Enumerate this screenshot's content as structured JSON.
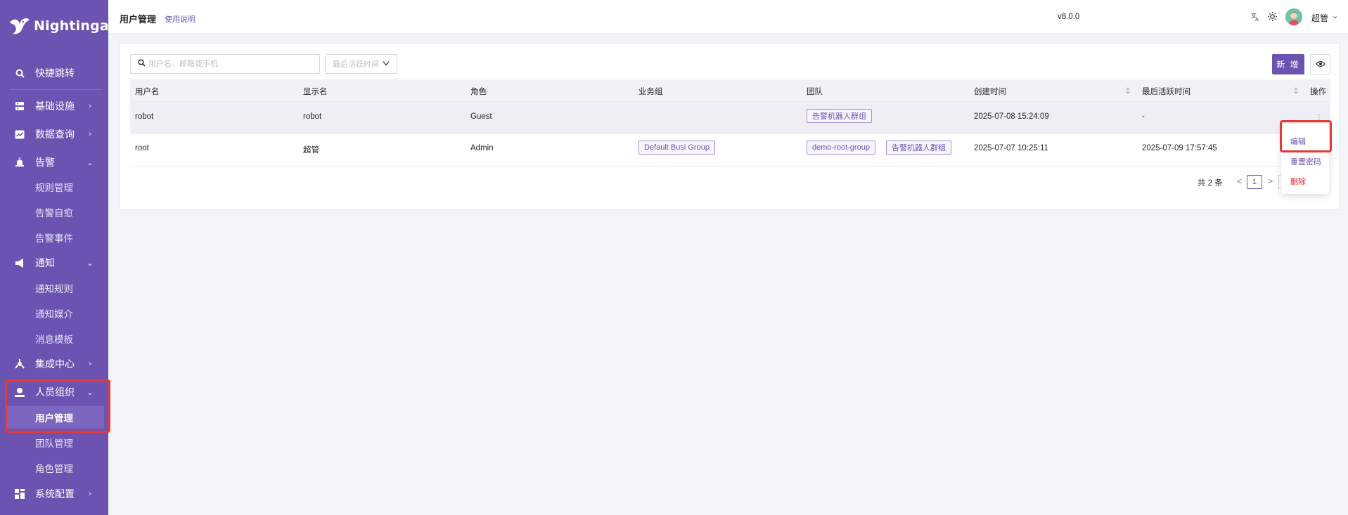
{
  "brand": {
    "name": "Nightingale"
  },
  "sidebar": {
    "items": [
      {
        "label": "快捷跳转",
        "icon": "search-icon"
      },
      {
        "label": "基础设施",
        "icon": "server-icon",
        "arrow": "›"
      },
      {
        "label": "数据查询",
        "icon": "chart-icon",
        "arrow": "›"
      },
      {
        "label": "告警",
        "icon": "alarm-icon",
        "arrow": "⌄",
        "children": [
          "规则管理",
          "告警自愈",
          "告警事件"
        ]
      },
      {
        "label": "通知",
        "icon": "megaphone-icon",
        "arrow": "⌄",
        "children": [
          "通知规则",
          "通知媒介",
          "消息模板"
        ]
      },
      {
        "label": "集成中心",
        "icon": "integration-icon",
        "arrow": "›"
      },
      {
        "label": "人员组织",
        "icon": "user-icon",
        "arrow": "⌄",
        "children": [
          "用户管理",
          "团队管理",
          "角色管理"
        ]
      },
      {
        "label": "系统配置",
        "icon": "grid-icon",
        "arrow": "›"
      }
    ],
    "active_child": "用户管理"
  },
  "header": {
    "title": "用户管理",
    "help_link": "使用说明",
    "version": "v8.0.0",
    "username": "超管",
    "chevron": "⌄"
  },
  "toolbar": {
    "search_placeholder": "用户名、邮箱或手机",
    "select_placeholder": "最后活跃时间",
    "add_button": "新 增"
  },
  "table": {
    "columns": [
      "用户名",
      "显示名",
      "角色",
      "业务组",
      "团队",
      "创建时间",
      "最后活跃时间",
      "操作"
    ],
    "rows": [
      {
        "username": "robot",
        "display_name": "robot",
        "role": "Guest",
        "busi_groups": [],
        "teams": [
          "告警机器人群组"
        ],
        "created": "2025-07-08 15:24:09",
        "last_active": "-"
      },
      {
        "username": "root",
        "display_name": "超管",
        "role": "Admin",
        "busi_groups": [
          "Default Busi Group"
        ],
        "teams": [
          "demo-root-group",
          "告警机器人群组"
        ],
        "created": "2025-07-07 10:25:11",
        "last_active": "2025-07-09 17:57:45"
      }
    ]
  },
  "pagination": {
    "total_text": "共 2 条",
    "current_page": "1",
    "prev": "<",
    "next": ">"
  },
  "row_menu": {
    "edit": "编辑",
    "reset_password": "重置密码",
    "delete": "删除"
  },
  "colors": {
    "primary": "#6c53b1",
    "danger": "#f5222d",
    "highlight": "#e53935"
  }
}
